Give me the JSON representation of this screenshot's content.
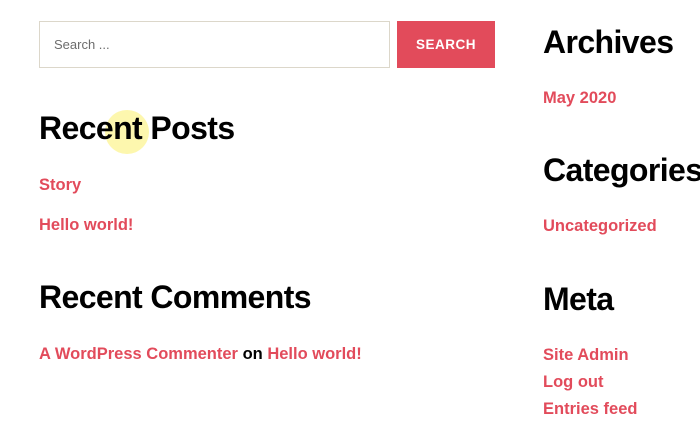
{
  "theme": {
    "accent": "#e24b5b",
    "text": "#000000",
    "border": "#dcd7ca"
  },
  "search": {
    "placeholder": "Search ...",
    "button_label": "SEARCH"
  },
  "recent_posts": {
    "title": "Recent Posts",
    "items": [
      "Story",
      "Hello world!"
    ]
  },
  "recent_comments": {
    "title": "Recent Comments",
    "items": [
      {
        "author": "A WordPress Commenter",
        "connector": "on",
        "post": "Hello world!"
      }
    ]
  },
  "archives": {
    "title": "Archives",
    "items": [
      "May 2020"
    ]
  },
  "categories": {
    "title": "Categories",
    "items": [
      "Uncategorized"
    ]
  },
  "meta": {
    "title": "Meta",
    "items": [
      "Site Admin",
      "Log out",
      "Entries feed"
    ]
  }
}
